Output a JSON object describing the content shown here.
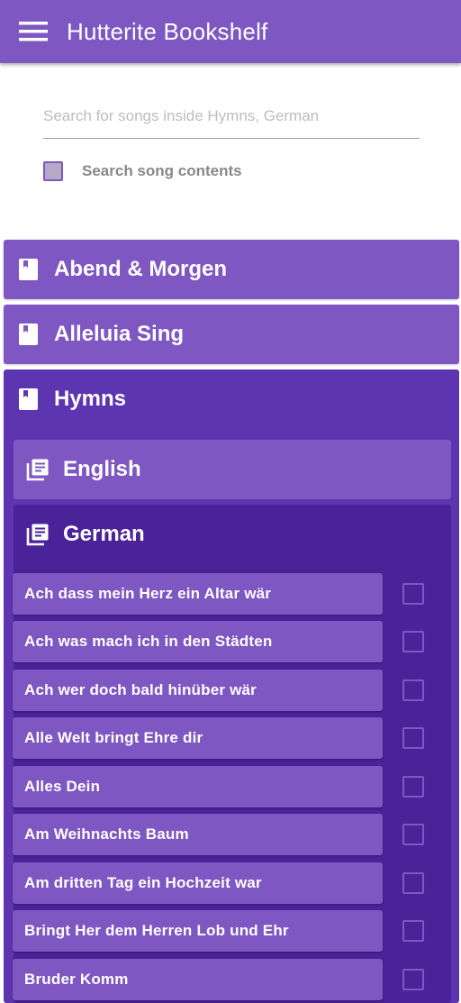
{
  "appbar": {
    "title": "Hutterite Bookshelf",
    "menu_icon": "menu-icon",
    "color": "#7e57c2"
  },
  "search": {
    "placeholder": "Search for songs inside Hymns, German",
    "value": "",
    "contents_label": "Search song contents",
    "contents_checked": false
  },
  "books": [
    {
      "label": "Abend & Morgen",
      "icon": "book-icon",
      "expanded": false
    },
    {
      "label": "Alleluia Sing",
      "icon": "book-icon",
      "expanded": false
    },
    {
      "label": "Hymns",
      "icon": "book-icon",
      "expanded": true
    }
  ],
  "hymns": {
    "sections": [
      {
        "label": "English",
        "icon": "library-books-icon",
        "expanded": false
      },
      {
        "label": "German",
        "icon": "library-books-icon",
        "expanded": true
      }
    ],
    "songs": [
      {
        "title": "Ach dass mein Herz ein Altar wär",
        "checked": false
      },
      {
        "title": "Ach was mach ich in den Städten",
        "checked": false
      },
      {
        "title": "Ach wer doch bald hinüber wär",
        "checked": false
      },
      {
        "title": "Alle Welt bringt Ehre dir",
        "checked": false
      },
      {
        "title": "Alles Dein",
        "checked": false
      },
      {
        "title": "Am Weihnachts Baum",
        "checked": false
      },
      {
        "title": "Am dritten Tag ein Hochzeit war",
        "checked": false
      },
      {
        "title": "Bringt Her dem Herren Lob und Ehr",
        "checked": false
      },
      {
        "title": "Bruder Komm",
        "checked": false
      }
    ]
  },
  "colors": {
    "primary": "#7e57c2",
    "panel": "#5e35b1",
    "subpanel": "#4a2399"
  }
}
